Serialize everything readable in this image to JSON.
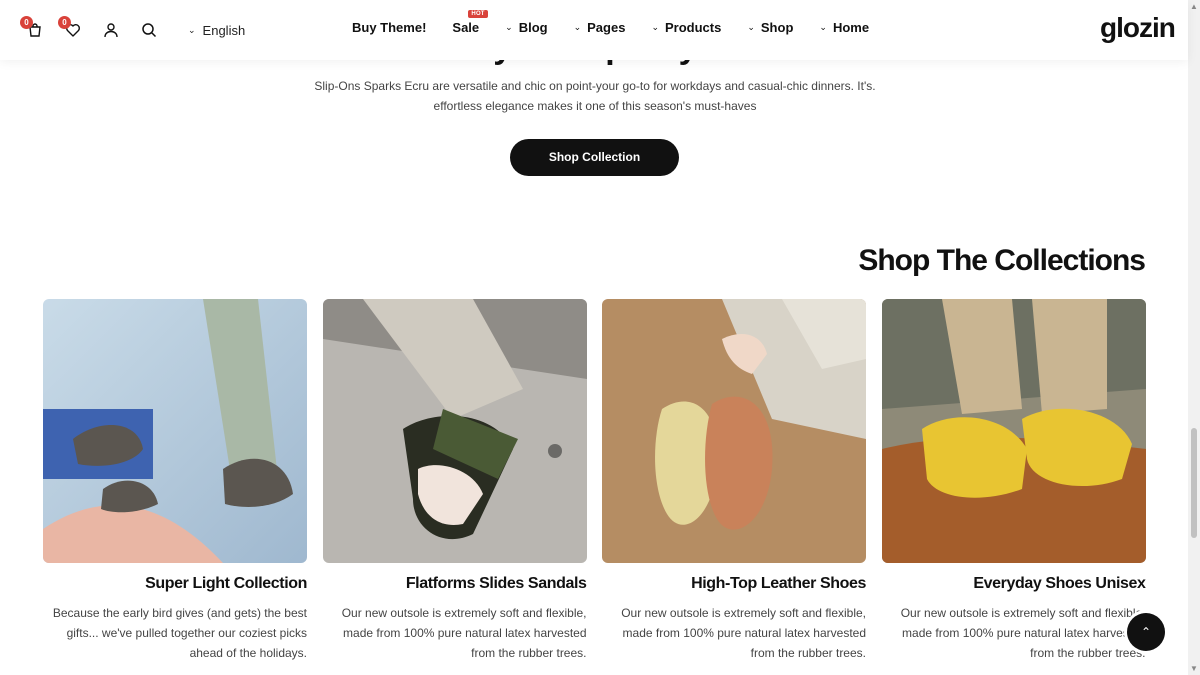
{
  "header": {
    "cart_count": "0",
    "wishlist_count": "0",
    "language": "English",
    "nav": [
      {
        "label": "Buy Theme!",
        "has_chevron": false
      },
      {
        "label": "Sale",
        "badge": "HOT",
        "has_chevron": false
      },
      {
        "label": "Blog",
        "has_chevron": true
      },
      {
        "label": "Pages",
        "has_chevron": true
      },
      {
        "label": "Products",
        "has_chevron": true
      },
      {
        "label": "Shop",
        "has_chevron": true
      },
      {
        "label": "Home",
        "has_chevron": true
      }
    ],
    "logo": "glozin"
  },
  "hero": {
    "title": "Luxury – Simplicity Of To",
    "desc_line1": "Slip-Ons Sparks Ecru are versatile and chic on point-your go-to for workdays and casual-chic dinners. It's.",
    "desc_line2": "effortless elegance makes it one of this season's must-haves",
    "button": "Shop Collection"
  },
  "collections": {
    "title": "Shop The Collections",
    "items": [
      {
        "title": "Super Light Collection",
        "lines": [
          "Because the early bird gives (and gets) the best",
          "gifts... we've pulled together our coziest picks",
          "ahead of the holidays."
        ]
      },
      {
        "title": "Flatforms Slides Sandals",
        "lines": [
          "Our new outsole is extremely soft and flexible,",
          "made from 100% pure natural latex harvested",
          "from the rubber trees."
        ]
      },
      {
        "title": "High-Top Leather Shoes",
        "lines": [
          "Our new outsole is extremely soft and flexible,",
          "made from 100% pure natural latex harvested",
          "from the rubber trees."
        ]
      },
      {
        "title": "Everyday Shoes Unisex",
        "lines": [
          "Our new outsole is extremely soft and flexible,",
          "made from 100% pure natural latex harvested",
          "from the rubber trees."
        ]
      }
    ]
  },
  "colors": {
    "accent": "#d9423a",
    "button": "#111111"
  }
}
